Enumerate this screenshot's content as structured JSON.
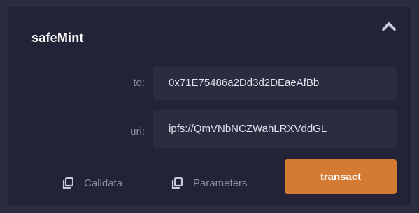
{
  "function": {
    "name": "safeMint"
  },
  "fields": [
    {
      "label": "to:",
      "value": "0x71E75486a2Dd3d2DEaeAfBb"
    },
    {
      "label": "uri:",
      "value": "ipfs://QmVNbNCZWahLRXVddGL"
    }
  ],
  "actions": {
    "calldata_label": "Calldata",
    "parameters_label": "Parameters",
    "transact_label": "transact"
  },
  "colors": {
    "background": "#2a2c3f",
    "panel": "#222336",
    "input": "#2a2c3f",
    "accent": "#d47a33",
    "muted_text": "#8a8ca8"
  }
}
